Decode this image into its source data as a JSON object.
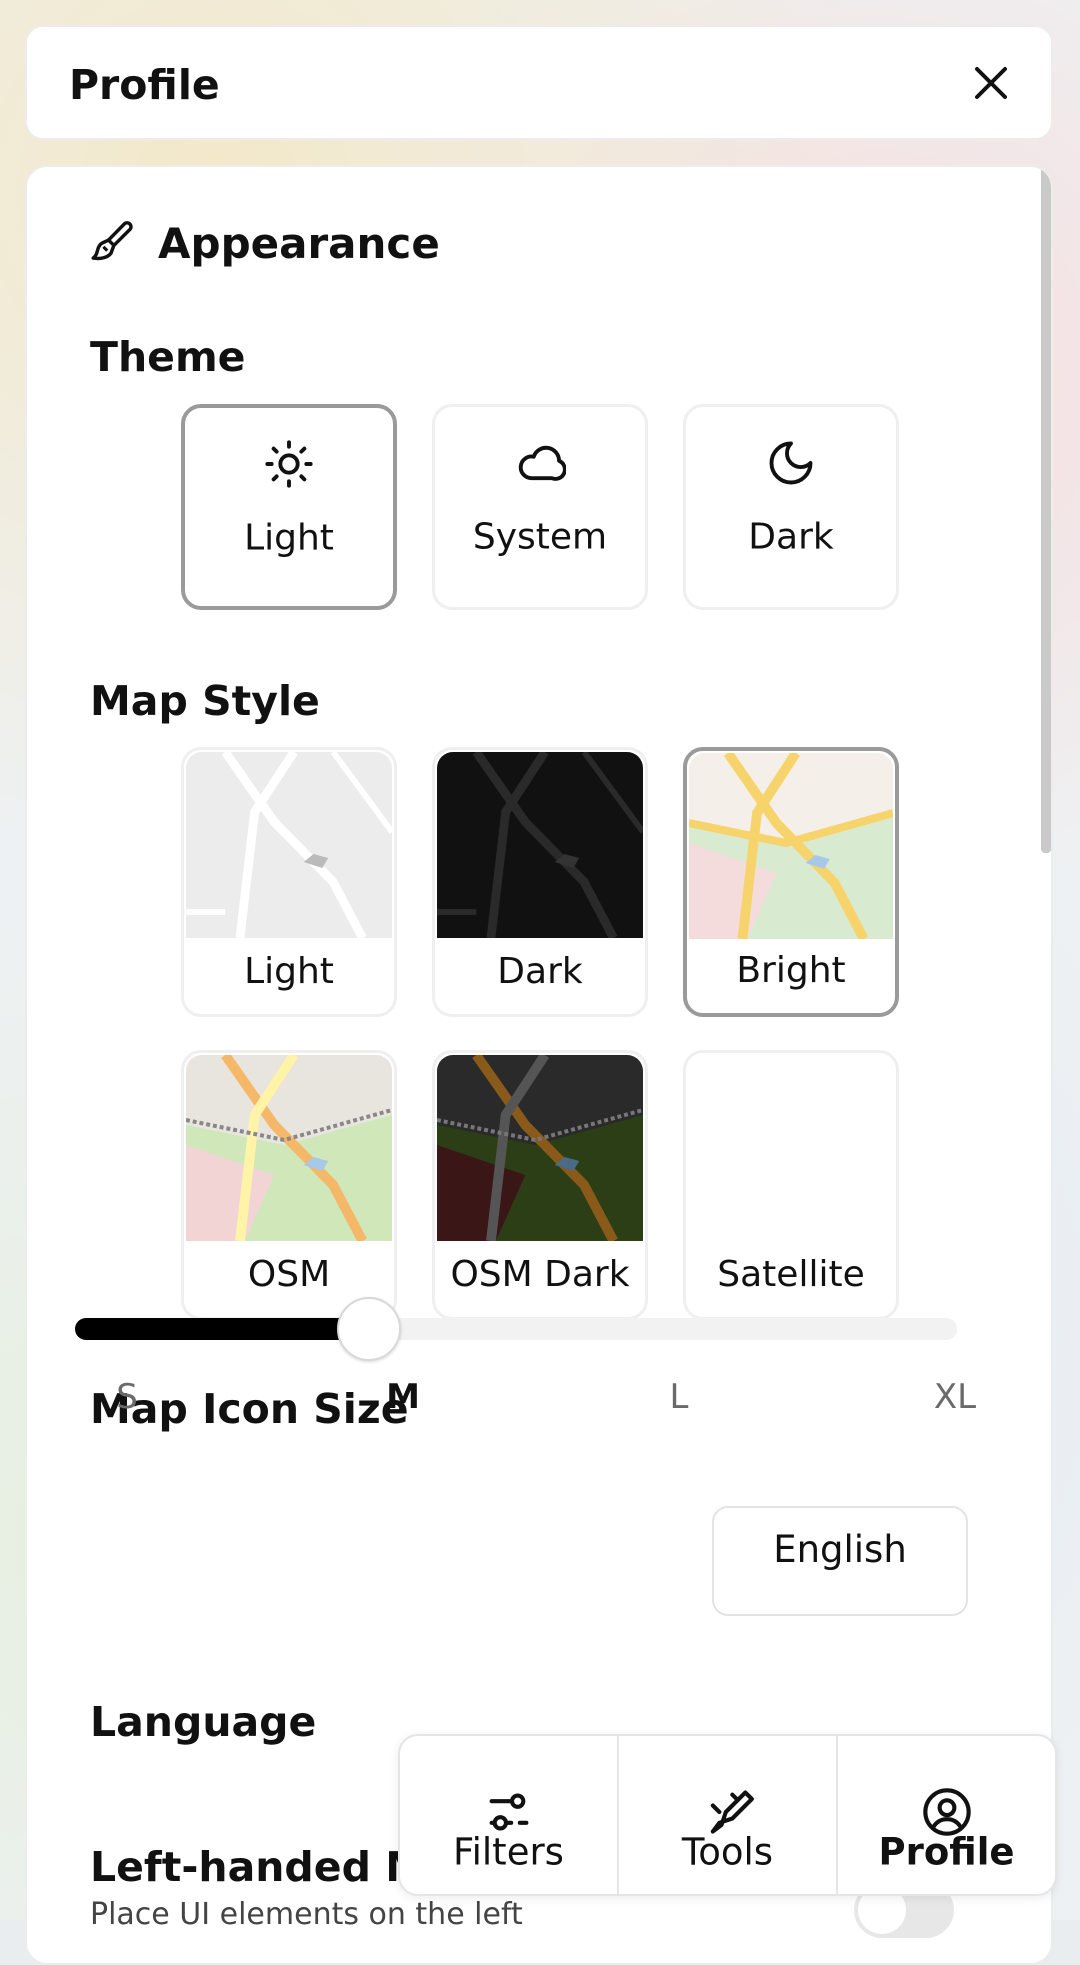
{
  "header": {
    "title": "Profile",
    "close_icon": "close-icon"
  },
  "appearance": {
    "section_title": "Appearance",
    "icon": "paintbrush-icon",
    "theme": {
      "label": "Theme",
      "options": [
        {
          "label": "Light",
          "icon": "sun-icon",
          "selected": true
        },
        {
          "label": "System",
          "icon": "cloud-icon",
          "selected": false
        },
        {
          "label": "Dark",
          "icon": "moon-icon",
          "selected": false
        }
      ]
    },
    "map_style": {
      "label": "Map Style",
      "options": [
        {
          "label": "Light",
          "selected": false
        },
        {
          "label": "Dark",
          "selected": false
        },
        {
          "label": "Bright",
          "selected": true
        },
        {
          "label": "OSM",
          "selected": false
        },
        {
          "label": "OSM Dark",
          "selected": false
        },
        {
          "label": "Satellite",
          "selected": false
        }
      ]
    },
    "map_icon_size": {
      "label": "Map Icon Size",
      "ticks": [
        "S",
        "M",
        "L",
        "XL"
      ],
      "selected": "M",
      "value_fraction": 0.333
    }
  },
  "language": {
    "label": "Language",
    "value": "English"
  },
  "left_handed": {
    "label": "Left-handed Mode",
    "description": "Place UI elements on the left",
    "enabled": false
  },
  "bottom_nav": {
    "items": [
      {
        "label": "Filters",
        "icon": "sliders-icon",
        "active": false
      },
      {
        "label": "Tools",
        "icon": "tools-icon",
        "active": false
      },
      {
        "label": "Profile",
        "icon": "user-circle-icon",
        "active": true
      }
    ]
  },
  "colors": {
    "accent": "#000000",
    "border": "#efefef",
    "selected_border": "#9a9a9a"
  }
}
